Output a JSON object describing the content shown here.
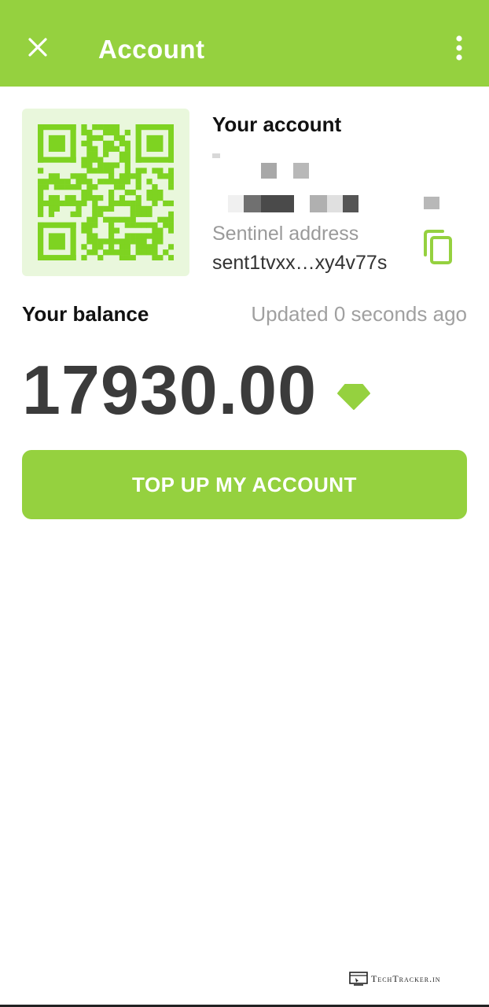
{
  "app_bar": {
    "title": "Account",
    "close_icon": "close-icon",
    "more_icon": "more-vertical-icon",
    "color": "#95d13f"
  },
  "account": {
    "heading": "Your account",
    "address_label": "Sentinel address",
    "address_value": "sent1tvxx…xy4v77s",
    "copy_icon": "copy-icon"
  },
  "balance": {
    "label": "Your balance",
    "updated": "Updated 0 seconds ago",
    "amount": "17930.00",
    "token_icon": "gem-icon"
  },
  "actions": {
    "top_up_label": "TOP UP MY ACCOUNT"
  },
  "watermark": {
    "text": "TechTracker.in"
  }
}
